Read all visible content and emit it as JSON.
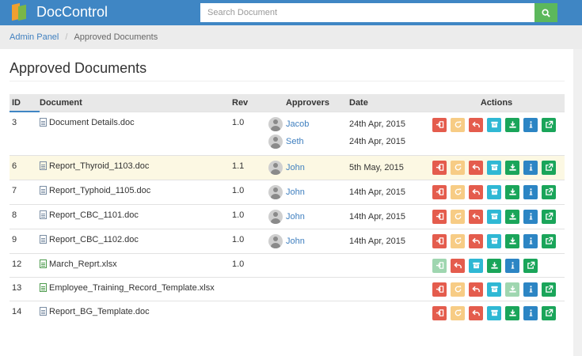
{
  "app": {
    "name": "DocControl"
  },
  "search": {
    "placeholder": "Search Document"
  },
  "breadcrumb": {
    "link": "Admin Panel",
    "separator": "/",
    "current": "Approved Documents"
  },
  "page_title": "Approved Documents",
  "columns": {
    "id": "ID",
    "document": "Document",
    "rev": "Rev",
    "approvers": "Approvers",
    "date": "Date",
    "actions": "Actions"
  },
  "colors": {
    "navbar": "#3f86c4",
    "search_button": "#5cb85c",
    "highlight_row": "#fcf8e3",
    "link": "#3f7fbf"
  },
  "rows": [
    {
      "id": "3",
      "document": "Document Details.doc",
      "file_type": "doc",
      "rev": "1.0",
      "highlight": false,
      "approvers": [
        {
          "name": "Jacob",
          "date": "24th Apr, 2015"
        },
        {
          "name": "Seth",
          "date": "24th Apr, 2015"
        }
      ],
      "actions": [
        "check-in",
        "renew",
        "revert",
        "archive",
        "download",
        "info",
        "open-external"
      ]
    },
    {
      "id": "6",
      "document": "Report_Thyroid_1103.doc",
      "file_type": "doc",
      "rev": "1.1",
      "highlight": true,
      "approvers": [
        {
          "name": "John",
          "date": "5th May, 2015"
        }
      ],
      "actions": [
        "check-in",
        "renew",
        "revert",
        "archive",
        "download",
        "info",
        "open-external"
      ]
    },
    {
      "id": "7",
      "document": "Report_Typhoid_1105.doc",
      "file_type": "doc",
      "rev": "1.0",
      "highlight": false,
      "approvers": [
        {
          "name": "John",
          "date": "14th Apr, 2015"
        }
      ],
      "actions": [
        "check-in",
        "renew",
        "revert",
        "archive",
        "download",
        "info",
        "open-external"
      ]
    },
    {
      "id": "8",
      "document": "Report_CBC_1101.doc",
      "file_type": "doc",
      "rev": "1.0",
      "highlight": false,
      "approvers": [
        {
          "name": "John",
          "date": "14th Apr, 2015"
        }
      ],
      "actions": [
        "check-in",
        "renew",
        "revert",
        "archive",
        "download",
        "info",
        "open-external"
      ]
    },
    {
      "id": "9",
      "document": "Report_CBC_1102.doc",
      "file_type": "doc",
      "rev": "1.0",
      "highlight": false,
      "approvers": [
        {
          "name": "John",
          "date": "14th Apr, 2015"
        }
      ],
      "actions": [
        "check-in",
        "renew",
        "revert",
        "archive",
        "download",
        "info",
        "open-external"
      ]
    },
    {
      "id": "12",
      "document": "March_Reprt.xlsx",
      "file_type": "xls",
      "rev": "1.0",
      "highlight": false,
      "approvers": [],
      "actions": [
        "check-in-light",
        "revert",
        "archive",
        "download",
        "info",
        "open-external"
      ]
    },
    {
      "id": "13",
      "document": "Employee_Training_Record_Template.xlsx",
      "file_type": "xls",
      "rev": "",
      "highlight": false,
      "approvers": [],
      "actions": [
        "check-in",
        "renew",
        "revert",
        "archive",
        "download-light",
        "info",
        "open-external"
      ]
    },
    {
      "id": "14",
      "document": "Report_BG_Template.doc",
      "file_type": "doc",
      "rev": "",
      "highlight": false,
      "approvers": [],
      "actions": [
        "check-in",
        "renew",
        "revert",
        "archive",
        "download",
        "info",
        "open-external"
      ]
    }
  ]
}
